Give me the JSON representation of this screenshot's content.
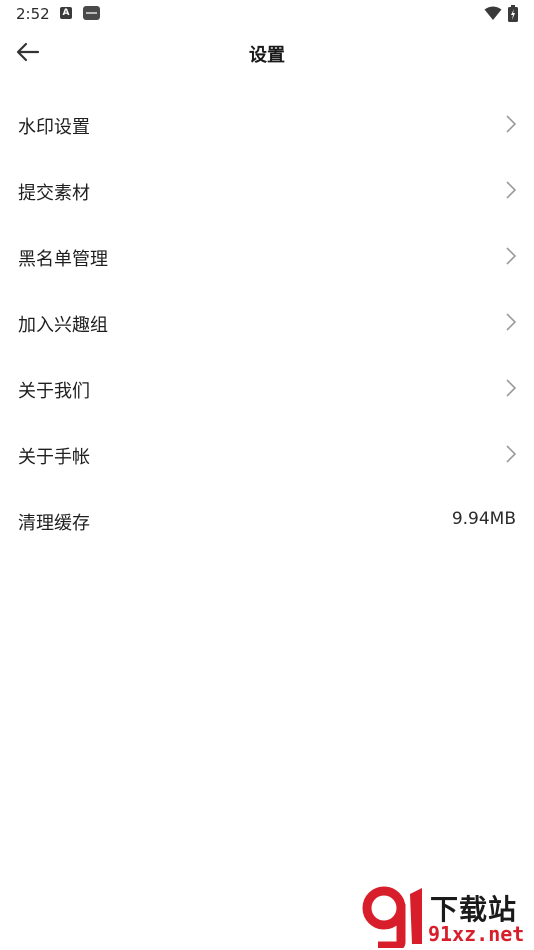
{
  "status_bar": {
    "time": "2:52",
    "icons": [
      "a-notification-icon",
      "app-notification-icon",
      "wifi-icon",
      "battery-icon"
    ]
  },
  "header": {
    "title": "设置",
    "back_icon": "arrow-left-icon"
  },
  "settings": [
    {
      "label": "水印设置",
      "has_chevron": true
    },
    {
      "label": "提交素材",
      "has_chevron": true
    },
    {
      "label": "黑名单管理",
      "has_chevron": true
    },
    {
      "label": "加入兴趣组",
      "has_chevron": true
    },
    {
      "label": "关于我们",
      "has_chevron": true
    },
    {
      "label": "关于手帐",
      "has_chevron": true
    },
    {
      "label": "清理缓存",
      "value": "9.94MB"
    }
  ],
  "watermark": {
    "title": "下载站",
    "url": "91xz.net"
  },
  "colors": {
    "background": "#ffffff",
    "text": "#1f1f1f",
    "chevron": "#9a9a9a",
    "watermark_red": "#d81e2a"
  }
}
